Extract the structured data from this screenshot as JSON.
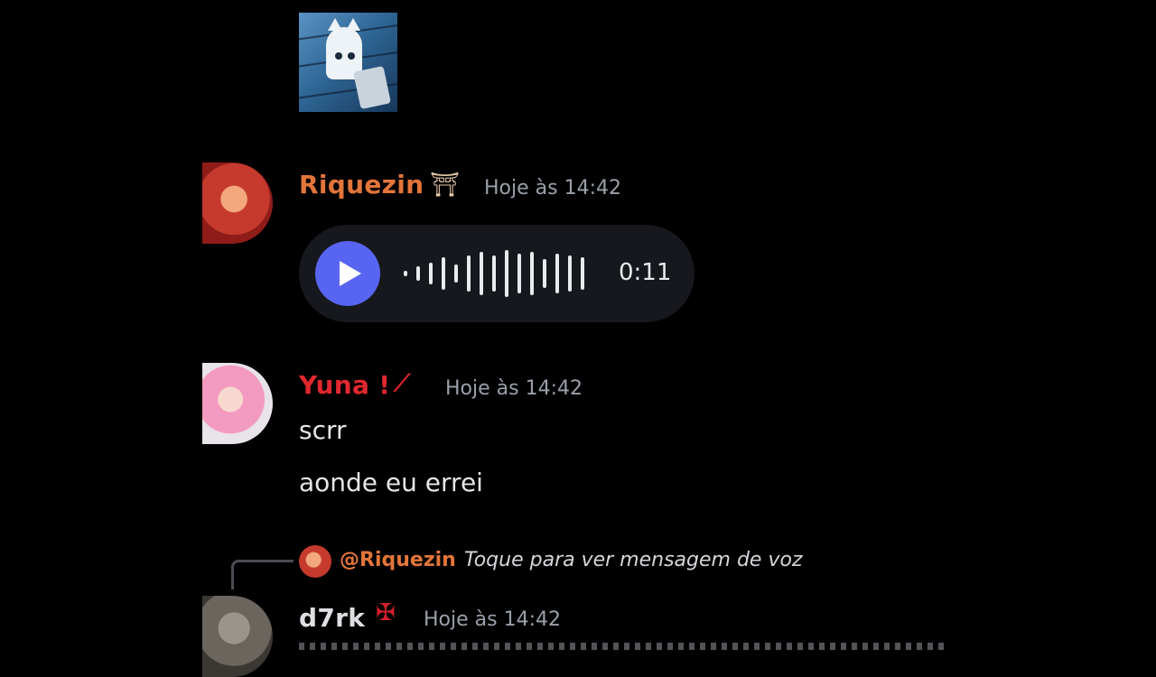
{
  "messages": [
    {
      "author": "Riquezin",
      "author_color": "#e2753a",
      "timestamp": "Hoje às 14:42",
      "badge_icon": "duo-figures-icon",
      "voice_message": {
        "duration": "0:11",
        "accent": "#5865f2"
      }
    },
    {
      "author": "Yuna !",
      "author_color": "#e0282e",
      "timestamp": "Hoje às 14:42",
      "badge_icon": "red-slash-icon",
      "lines": [
        "scrr",
        "aonde eu errei"
      ]
    },
    {
      "reply": {
        "mention": "@Riquezin",
        "preview": "Toque para ver mensagem de voz"
      },
      "author": "d7rk",
      "author_color": "#dedee3",
      "timestamp": "Hoje às 14:42",
      "badge_icon": "red-emblem-icon"
    }
  ],
  "attachment": {
    "icon": "ghost-cat-image"
  }
}
